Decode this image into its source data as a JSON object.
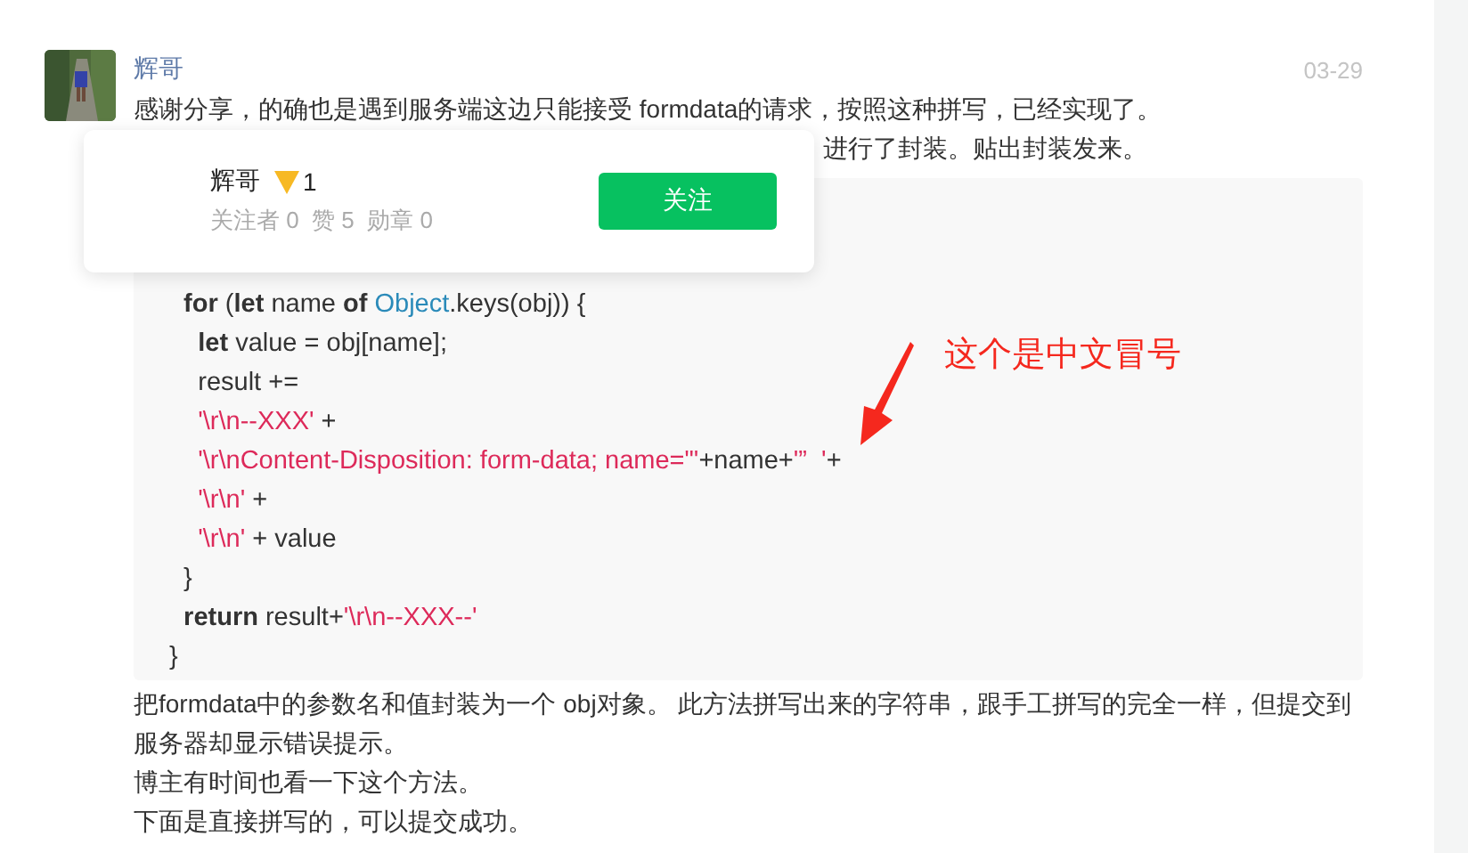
{
  "comment": {
    "author": "辉哥",
    "date": "03-29",
    "intro_lines": [
      "感谢分享，的确也是遇到服务端这边只能接受 formdata的请求，按照这种拼写，已经实现了。",
      "进行了封装。贴出封装发来。"
    ],
    "code_lines": [
      [
        {
          "kind": "keyword",
          "text": "  for"
        },
        {
          "kind": "plain",
          "text": " ("
        },
        {
          "kind": "keyword",
          "text": "let"
        },
        {
          "kind": "plain",
          "text": " name "
        },
        {
          "kind": "keyword",
          "text": "of"
        },
        {
          "kind": "builtin",
          "text": " Object"
        },
        {
          "kind": "plain",
          "text": ".keys(obj)) {"
        }
      ],
      [
        {
          "kind": "keyword",
          "text": "    let"
        },
        {
          "kind": "plain",
          "text": " value = obj[name];"
        }
      ],
      [
        {
          "kind": "plain",
          "text": "    result +="
        }
      ],
      [
        {
          "kind": "string",
          "text": "    '\\r\\n--XXX'"
        },
        {
          "kind": "plain",
          "text": " +"
        }
      ],
      [
        {
          "kind": "string",
          "text": "    '\\r\\nContent-Disposition: form-data; name=\"'"
        },
        {
          "kind": "plain",
          "text": "+name+"
        },
        {
          "kind": "string",
          "text": "'”  '"
        },
        {
          "kind": "plain",
          "text": "+"
        }
      ],
      [
        {
          "kind": "string",
          "text": "    '\\r\\n'"
        },
        {
          "kind": "plain",
          "text": " +"
        }
      ],
      [
        {
          "kind": "string",
          "text": "    '\\r\\n'"
        },
        {
          "kind": "plain",
          "text": " + value"
        }
      ],
      [
        {
          "kind": "plain",
          "text": "  }"
        }
      ],
      [
        {
          "kind": "keyword",
          "text": "  return"
        },
        {
          "kind": "plain",
          "text": " result+"
        },
        {
          "kind": "string",
          "text": "'\\r\\n--XXX--'"
        }
      ],
      [
        {
          "kind": "plain",
          "text": "}"
        }
      ]
    ],
    "annotation": "这个是中文冒号",
    "after_lines": [
      "把formdata中的参数名和值封装为一个 obj对象。 此方法拼写出来的字符串，跟手工拼写的完全一样，但提交到服务器却显示错误提示。",
      "博主有时间也看一下这个方法。",
      "下面是直接拼写的，可以提交成功。"
    ]
  },
  "user_card": {
    "name": "辉哥",
    "level": "1",
    "stats": "关注者 0  赞 5  勋章 0",
    "follow_button": "关注"
  }
}
